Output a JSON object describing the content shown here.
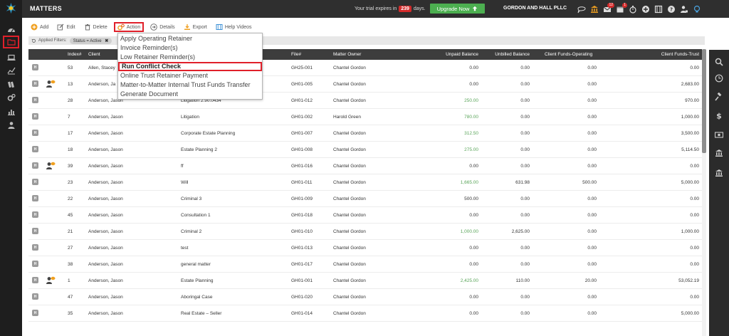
{
  "header": {
    "title": "MATTERS",
    "trial_prefix": "Your trial expires in",
    "trial_days": "239",
    "trial_suffix": "days.",
    "upgrade_label": "Upgrade Now",
    "firm_name": "GORDON AND HALL PLLC",
    "mail_badge": "12",
    "calendar_badge": "1"
  },
  "toolbar": {
    "add": "Add",
    "edit": "Edit",
    "delete": "Delete",
    "action": "Action",
    "details": "Details",
    "export": "Export",
    "help": "Help Videos"
  },
  "filters": {
    "label": "Applied Filters:",
    "chip": "Status = Active"
  },
  "dropdown": {
    "items": [
      "Apply Operating Retainer",
      "Invoice Reminder(s)",
      "Low Retainer Reminder(s)",
      "Run Conflict Check",
      "Online Trust Retainer Payment",
      "Matter-to-Matter Internal Trust Funds Transfer",
      "Generate Document"
    ]
  },
  "table": {
    "columns": {
      "index": "Index#",
      "client": "Client",
      "file": "File#",
      "owner": "Matter Owner",
      "unpaid": "Unpaid Balance",
      "unbilled": "Unbilled Balance",
      "operating": "Client Funds-Operating",
      "trust": "Client Funds-Trust"
    },
    "rows": [
      {
        "index": "53",
        "client": "Allen, Stacey",
        "matter": "",
        "file": "GH25-001",
        "owner": "Chantel Gordon",
        "unpaid": "0.00",
        "unbilled": "0.00",
        "operating": "0.00",
        "trust": "0.00",
        "portal": false
      },
      {
        "index": "13",
        "client": "Anderson, Ja",
        "matter": "",
        "file": "GH01-005",
        "owner": "Chantel Gordon",
        "unpaid": "0.00",
        "unbilled": "0.00",
        "operating": "0.00",
        "trust": "2,683.00",
        "portal": true
      },
      {
        "index": "28",
        "client": "Anderson, Jason",
        "matter": "Litigation 2.90.0434",
        "file": "GH01-012",
        "owner": "Chantel Gordon",
        "unpaid": "250.00",
        "unbilled": "0.00",
        "operating": "0.00",
        "trust": "970.00",
        "portal": false
      },
      {
        "index": "7",
        "client": "Anderson, Jason",
        "matter": "Litigation",
        "file": "GH01-002",
        "owner": "Harold Green",
        "unpaid": "780.00",
        "unbilled": "0.00",
        "operating": "0.00",
        "trust": "1,000.00",
        "portal": false
      },
      {
        "index": "17",
        "client": "Anderson, Jason",
        "matter": "Corporate Estate Planning",
        "file": "GH01-007",
        "owner": "Chantel Gordon",
        "unpaid": "312.50",
        "unbilled": "0.00",
        "operating": "0.00",
        "trust": "3,500.00",
        "portal": false
      },
      {
        "index": "18",
        "client": "Anderson, Jason",
        "matter": "Estate Planning 2",
        "file": "GH01-008",
        "owner": "Chantel Gordon",
        "unpaid": "275.00",
        "unbilled": "0.00",
        "operating": "0.00",
        "trust": "5,114.50",
        "portal": false
      },
      {
        "index": "39",
        "client": "Anderson, Jason",
        "matter": "ff",
        "file": "GH01-016",
        "owner": "Chantel Gordon",
        "unpaid": "0.00",
        "unbilled": "0.00",
        "operating": "0.00",
        "trust": "0.00",
        "portal": true
      },
      {
        "index": "23",
        "client": "Anderson, Jason",
        "matter": "Will",
        "file": "GH01-011",
        "owner": "Chantel Gordon",
        "unpaid": "1,665.00",
        "unbilled": "631.98",
        "operating": "500.00",
        "trust": "5,000.00",
        "portal": false
      },
      {
        "index": "22",
        "client": "Anderson, Jason",
        "matter": "Criminal 3",
        "file": "GH01-009",
        "owner": "Chantel Gordon",
        "unpaid": "500.00",
        "unbilled": "0.00",
        "operating": "0.00",
        "trust": "0.00",
        "portal": false
      },
      {
        "index": "45",
        "client": "Anderson, Jason",
        "matter": "Consultation 1",
        "file": "GH01-018",
        "owner": "Chantel Gordon",
        "unpaid": "0.00",
        "unbilled": "0.00",
        "operating": "0.00",
        "trust": "0.00",
        "portal": false
      },
      {
        "index": "21",
        "client": "Anderson, Jason",
        "matter": "Criminal 2",
        "file": "GH01-010",
        "owner": "Chantel Gordon",
        "unpaid": "1,000.00",
        "unbilled": "2,625.00",
        "operating": "0.00",
        "trust": "1,000.00",
        "portal": false
      },
      {
        "index": "27",
        "client": "Anderson, Jason",
        "matter": "test",
        "file": "GH01-013",
        "owner": "Chantel Gordon",
        "unpaid": "0.00",
        "unbilled": "0.00",
        "operating": "0.00",
        "trust": "0.00",
        "portal": false
      },
      {
        "index": "38",
        "client": "Anderson, Jason",
        "matter": "general matter",
        "file": "GH01-017",
        "owner": "Chantel Gordon",
        "unpaid": "0.00",
        "unbilled": "0.00",
        "operating": "0.00",
        "trust": "0.00",
        "portal": false
      },
      {
        "index": "1",
        "client": "Anderson, Jason",
        "matter": "Estate Planning",
        "file": "GH01-001",
        "owner": "Chantel Gordon",
        "unpaid": "2,425.00",
        "unbilled": "110.00",
        "operating": "20.00",
        "trust": "53,052.19",
        "portal": true
      },
      {
        "index": "47",
        "client": "Anderson, Jason",
        "matter": "Aboringal Case",
        "file": "GH01-020",
        "owner": "Chantel Gordon",
        "unpaid": "0.00",
        "unbilled": "0.00",
        "operating": "0.00",
        "trust": "0.00",
        "portal": false
      },
      {
        "index": "35",
        "client": "Anderson, Jason",
        "matter": "Real Estate – Seller",
        "file": "GH01-014",
        "owner": "Chantel Gordon",
        "unpaid": "0.00",
        "unbilled": "0.00",
        "operating": "0.00",
        "trust": "5,000.00",
        "portal": false
      }
    ]
  },
  "colors": {
    "accent_red": "#e0202a",
    "upgrade_green": "#4caf50",
    "paid_green": "#5aa55a",
    "header_dark": "#2f2f2f"
  },
  "icons": {
    "sidebar": [
      "logo-icon",
      "dashboard-icon",
      "folder-icon",
      "laptop-icon",
      "chart-line-icon",
      "books-icon",
      "cogs-icon",
      "bar-chart-icon",
      "user-icon"
    ],
    "right_rail": [
      "search-icon",
      "clock-icon",
      "gavel-icon",
      "dollar-icon",
      "money-icon",
      "bank-icon",
      "bank-transfer-icon"
    ]
  }
}
